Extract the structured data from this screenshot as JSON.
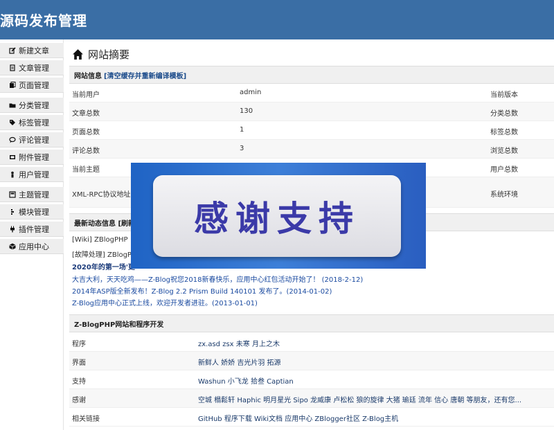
{
  "app_title": "源码发布管理",
  "sidebar": [
    {
      "label": "新建文章",
      "icon": "edit-icon"
    },
    {
      "label": "文章管理",
      "icon": "document-icon"
    },
    {
      "label": "页面管理",
      "icon": "pages-icon"
    },
    {
      "label": "分类管理",
      "icon": "folder-icon"
    },
    {
      "label": "标签管理",
      "icon": "tag-icon"
    },
    {
      "label": "评论管理",
      "icon": "comment-icon"
    },
    {
      "label": "附件管理",
      "icon": "attachment-icon"
    },
    {
      "label": "用户管理",
      "icon": "user-icon"
    },
    {
      "label": "主题管理",
      "icon": "theme-icon"
    },
    {
      "label": "模块管理",
      "icon": "module-icon"
    },
    {
      "label": "插件管理",
      "icon": "plugin-icon"
    },
    {
      "label": "应用中心",
      "icon": "app-center-icon"
    }
  ],
  "page_title": "网站摘要",
  "site_info": {
    "heading": "网站信息",
    "clear_cache": "[清空缓存并重新编译模板]",
    "rows": [
      {
        "label": "当前用户",
        "value": "admin",
        "right": "当前版本"
      },
      {
        "label": "文章总数",
        "value": "130",
        "right": "分类总数"
      },
      {
        "label": "页面总数",
        "value": "1",
        "right": "标签总数"
      },
      {
        "label": "评论总数",
        "value": "3",
        "right": "浏览总数"
      },
      {
        "label": "当前主题",
        "value": "",
        "right": "用户总数"
      },
      {
        "label": "XML-RPC协议地址",
        "value": "",
        "right": "系统环境"
      }
    ]
  },
  "news": {
    "heading": "最新动态信息 [刷新",
    "items": [
      "[Wiki]   ZBlogPHP",
      "[故障处理]   ZBlogP",
      "2020年的第一场'更",
      "大吉大利，天天吃鸡——Z-Blog祝您2018新春快乐，应用中心红包活动开始了！ (2018-2-12)",
      "2014年ASP版全新发布！Z-Blog 2.2 Prism Build 140101 发布了。(2014-01-02)",
      "Z-Blog应用中心正式上线，欢迎开发者进驻。(2013-01-01)"
    ]
  },
  "dev": {
    "heading": "Z-BlogPHP网站和程序开发",
    "rows": [
      {
        "label": "程序",
        "value": "zx.asd zsx 未寒 月上之木"
      },
      {
        "label": "界面",
        "value": "新鲜人 娇娇 吉光片羽 拓源"
      },
      {
        "label": "支持",
        "value": "Washun 小飞龙 拾叁 Captian"
      },
      {
        "label": "感谢",
        "value": "空城 榻鬆轩 Haphic 明月星光 Sipo 龙威康 卢松松 狼的旋律 大猪 瑜廷 流年 信心 唐朝 等朋友，还有您..."
      },
      {
        "label": "相关链接",
        "value": "GitHub 程序下载  Wiki文档  应用中心  ZBlogger社区  Z-Blog主机"
      }
    ]
  },
  "overlay_text": "感谢支持"
}
